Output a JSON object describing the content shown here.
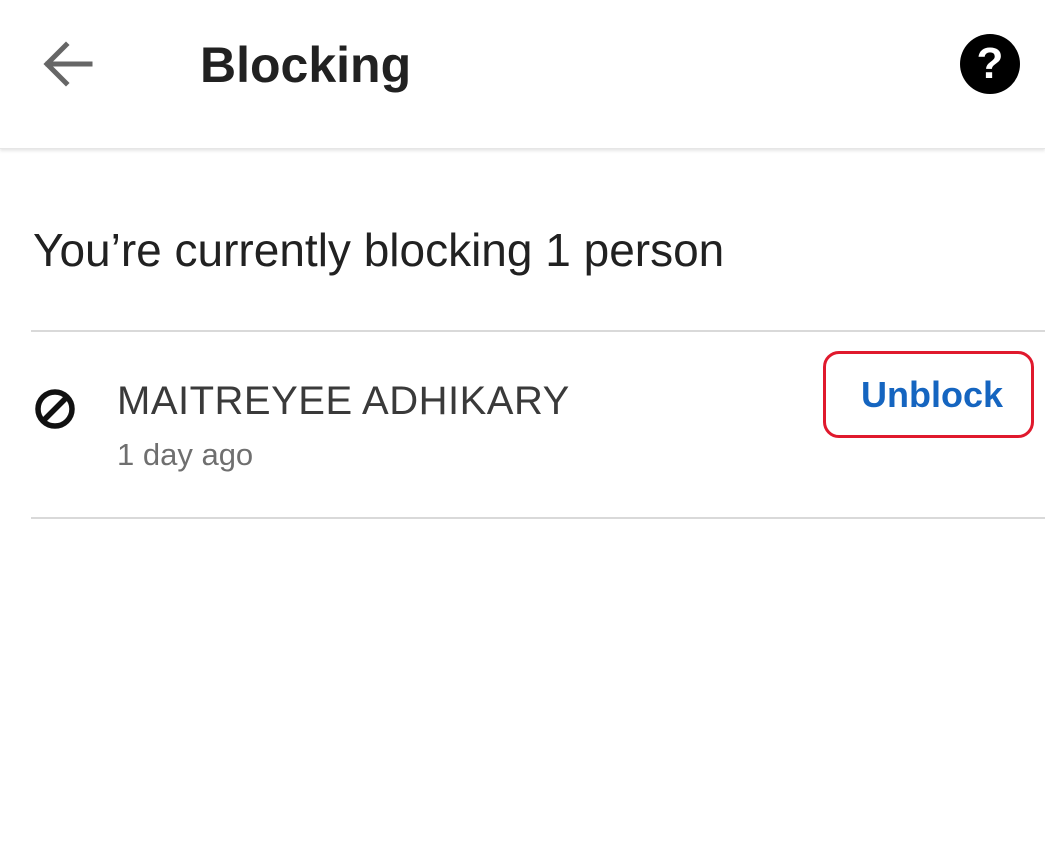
{
  "header": {
    "back_icon": "arrow-left-icon",
    "title": "Blocking",
    "help_icon": "help-circle-icon",
    "help_glyph": "?"
  },
  "summary": {
    "text": "You’re currently blocking 1 person"
  },
  "blocked_list": [
    {
      "icon": "block-icon",
      "name": "MAITREYEE ADHIKARY",
      "time": "1 day ago",
      "action_label": "Unblock"
    }
  ],
  "colors": {
    "action": "#1565c0",
    "highlight_outline": "#e0192d",
    "divider": "#d9d9d9"
  }
}
